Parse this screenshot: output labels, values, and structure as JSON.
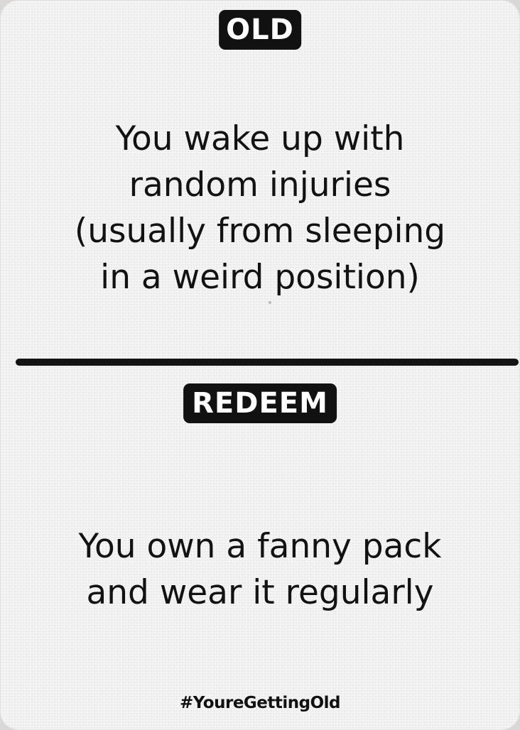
{
  "card": {
    "old_label": "OLD",
    "old_text_lines": [
      "You wake up with",
      "random injuries",
      "(usually from sleeping",
      "in a weird position)"
    ],
    "redeem_label": "REDEEM",
    "redeem_text_lines": [
      "You own a fanny pack",
      "and wear it regularly"
    ],
    "hashtag": "#YoureGettingOld"
  },
  "colors": {
    "card_background": "#f4f4f4",
    "ink": "#111111",
    "badge_text": "#ffffff"
  }
}
